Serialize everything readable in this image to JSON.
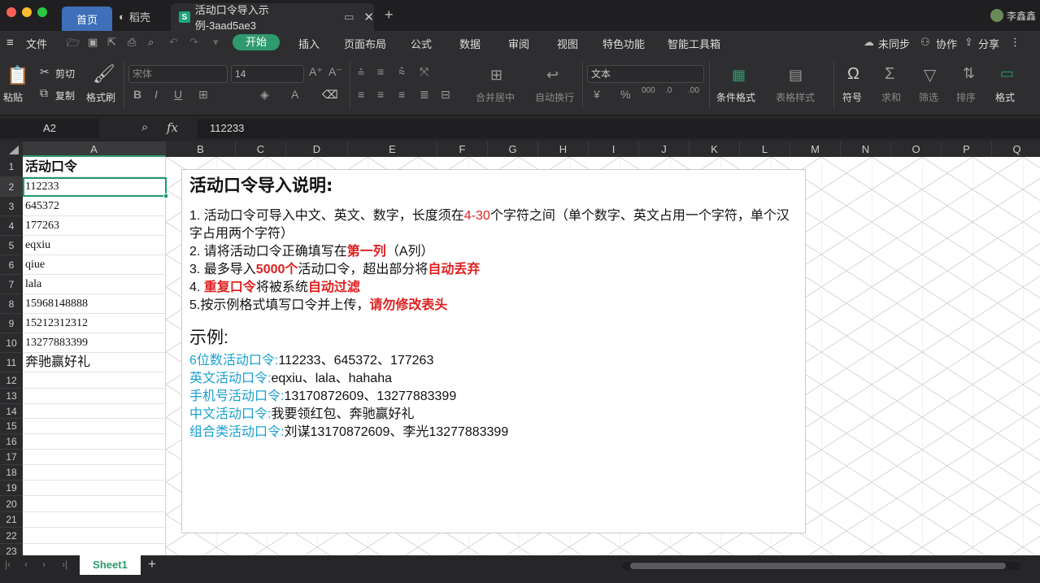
{
  "tabs": {
    "home": "首页",
    "shell": "稻壳",
    "doc": "活动口令导入示例-3aad5ae3"
  },
  "user": "李鑫鑫",
  "menu": {
    "file": "文件",
    "start": "开始",
    "insert": "插入",
    "layout": "页面布局",
    "formula": "公式",
    "data": "数据",
    "review": "审阅",
    "view": "视图",
    "special": "特色功能",
    "tools": "智能工具箱",
    "sync": "未同步",
    "collab": "协作",
    "share": "分享"
  },
  "ribbon": {
    "paste": "粘贴",
    "cut": "剪切",
    "copy": "复制",
    "format_painter": "格式刷",
    "font": "宋体",
    "size": "14",
    "merge": "合并居中",
    "wrap": "自动换行",
    "numfmt": "文本",
    "cond": "条件格式",
    "tablestyle": "表格样式",
    "symbol": "符号",
    "sum": "求和",
    "filter": "筛选",
    "sort": "排序",
    "format": "格式"
  },
  "formula": {
    "cell": "A2",
    "fx": "fx",
    "value": "112233"
  },
  "columns": [
    "A",
    "B",
    "C",
    "D",
    "E",
    "F",
    "G",
    "H",
    "I",
    "J",
    "K",
    "L",
    "M",
    "N",
    "O",
    "P",
    "Q"
  ],
  "rows": [
    "1",
    "2",
    "3",
    "4",
    "5",
    "6",
    "7",
    "8",
    "9",
    "10",
    "11",
    "12",
    "13",
    "14",
    "15",
    "16",
    "17",
    "18",
    "19",
    "20",
    "21",
    "22",
    "23"
  ],
  "cells": [
    "活动口令",
    "112233",
    "645372",
    "177263",
    "eqxiu",
    "qiue",
    "lala",
    "15968148888",
    "15212312312",
    "13277883399",
    "奔驰赢好礼"
  ],
  "note": {
    "title": "活动口令导入说明:",
    "l1a": "1. 活动口令可导入中文、英文、数字，长度须在",
    "l1b": "4-30",
    "l1c": "个字符之间（单个数字、英文占用一个字符，单个汉字占用两个字符）",
    "l2a": "2. 请将活动口令正确填写在",
    "l2b": "第一列",
    "l2c": "（A列）",
    "l3a": "3. 最多导入",
    "l3b": "5000个",
    "l3c": "活动口令，超出部分将",
    "l3d": "自动丢弃",
    "l4a": "4. ",
    "l4b": "重复口令",
    "l4c": "将被系统",
    "l4d": "自动过滤",
    "l5a": "5.按示例格式填写口令并上传，",
    "l5b": "请勿修改表头",
    "ex_title": "示例:",
    "e1a": "6位数活动口令:",
    "e1b": "112233、645372、177263",
    "e2a": "英文活动口令:",
    "e2b": "eqxiu、lala、hahaha",
    "e3a": "手机号活动口令:",
    "e3b": "13170872609、13277883399",
    "e4a": "中文活动口令:",
    "e4b": "我要领红包、奔驰赢好礼",
    "e5a": "组合类活动口令:",
    "e5b": "刘谋13170872609、李光13277883399"
  },
  "sheet": "Sheet1",
  "colors": {
    "accent": "#2e9a6d",
    "tab": "#3e6fb8",
    "red": "#e02020",
    "cyan": "#1aa0d0"
  }
}
